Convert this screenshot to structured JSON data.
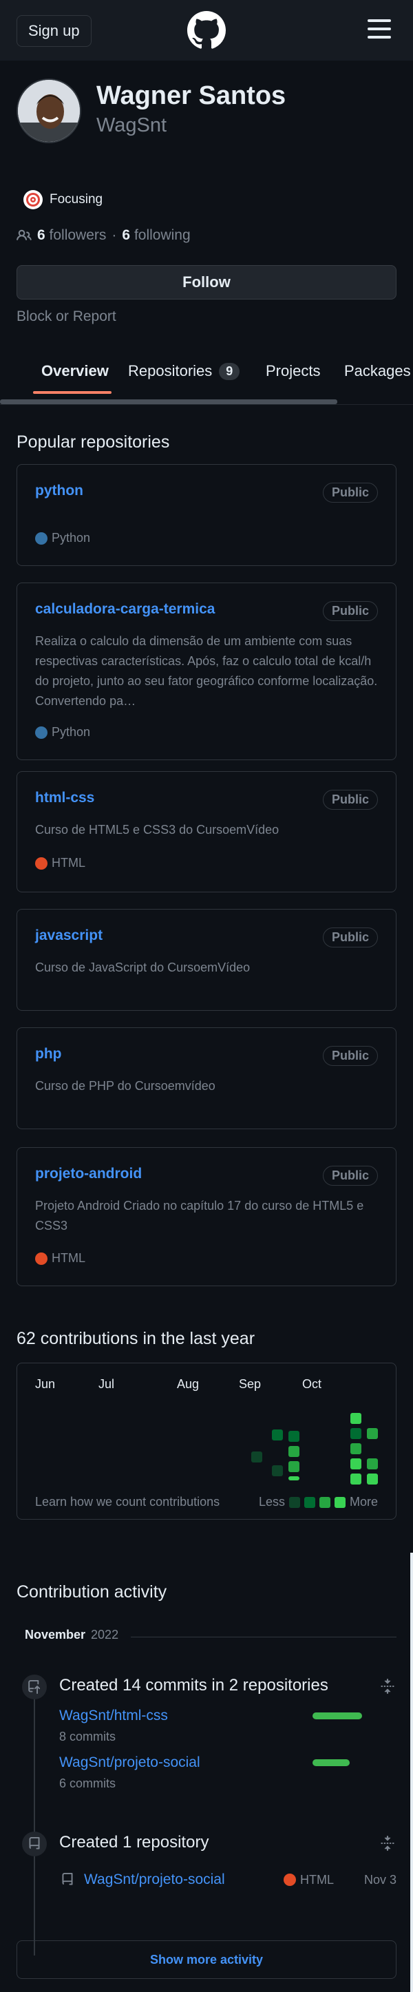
{
  "header": {
    "signup": "Sign up",
    "logo_icon": "github-logo-icon",
    "menu_icon": "hamburger-icon"
  },
  "profile": {
    "name": "Wagner Santos",
    "username": "WagSnt",
    "status": {
      "emoji": "🎯",
      "text": "Focusing"
    },
    "followers_count": "6",
    "followers_label": "followers",
    "separator": "·",
    "following_count": "6",
    "following_label": "following",
    "follow_button": "Follow",
    "block_report": "Block or Report"
  },
  "tabs": [
    {
      "label": "Overview",
      "active": true
    },
    {
      "label": "Repositories",
      "count": "9"
    },
    {
      "label": "Projects"
    },
    {
      "label": "Packages"
    }
  ],
  "popular": {
    "title": "Popular repositories",
    "repos": [
      {
        "name": "python",
        "visibility": "Public",
        "description": "",
        "language": "Python",
        "lang_color": "#3572A5"
      },
      {
        "name": "calculadora-carga-termica",
        "visibility": "Public",
        "description": "Realiza o calculo da dimensão de um ambiente com suas respectivas características. Após, faz o calculo total de kcal/h do projeto, junto ao seu fator geográfico conforme localização. Convertendo pa…",
        "language": "Python",
        "lang_color": "#3572A5"
      },
      {
        "name": "html-css",
        "visibility": "Public",
        "description": "Curso de HTML5 e CSS3 do CursoemVídeo",
        "language": "HTML",
        "lang_color": "#e34c26"
      },
      {
        "name": "javascript",
        "visibility": "Public",
        "description": "Curso de JavaScript do CursoemVídeo",
        "language": "",
        "lang_color": ""
      },
      {
        "name": "php",
        "visibility": "Public",
        "description": "Curso de PHP do Cursoemvídeo",
        "language": "",
        "lang_color": ""
      },
      {
        "name": "projeto-android",
        "visibility": "Public",
        "description": "Projeto Android Criado no capítulo 17 do curso de HTML5 e CSS3",
        "language": "HTML",
        "lang_color": "#e34c26"
      }
    ]
  },
  "contributions": {
    "title": "62 contributions in the last year",
    "months": [
      "Jun",
      "Jul",
      "Aug",
      "Sep",
      "Oct"
    ],
    "learn": "Learn how we count contributions",
    "less": "Less",
    "more": "More",
    "colors": [
      "#0e4429",
      "#006d32",
      "#26a641",
      "#39d353"
    ]
  },
  "activity": {
    "title": "Contribution activity",
    "month": "November",
    "year": "2022",
    "commits": {
      "title": "Created 14 commits in 2 repositories",
      "repos": [
        {
          "name": "WagSnt/html-css",
          "count": "8 commits"
        },
        {
          "name": "WagSnt/projeto-social",
          "count": "6 commits"
        }
      ]
    },
    "created": {
      "title": "Created 1 repository",
      "repo": "WagSnt/projeto-social",
      "language": "HTML",
      "lang_color": "#e34c26",
      "date": "Nov 3"
    },
    "show_more": "Show more activity"
  }
}
